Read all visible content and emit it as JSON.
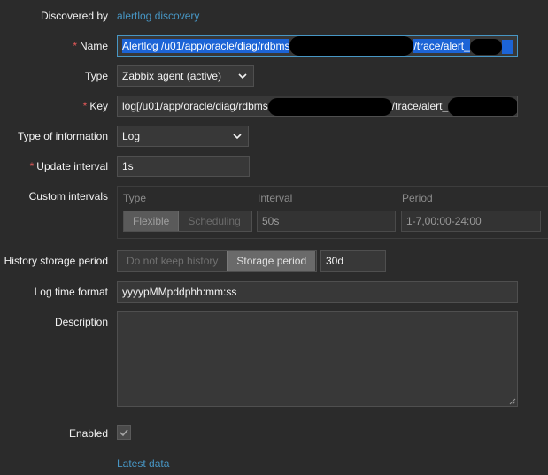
{
  "discovered_by": {
    "label": "Discovered by",
    "link": "alertlog discovery"
  },
  "name": {
    "label": "Name",
    "value_prefix": "Alertlog /u01/app/oracle/diag/rdbms",
    "value_middle": "/trace/alert_"
  },
  "type": {
    "label": "Type",
    "value": "Zabbix agent (active)"
  },
  "key": {
    "label": "Key",
    "value_prefix": "log[/u01/app/oracle/diag/rdbms",
    "value_middle": "/trace/alert_"
  },
  "type_of_information": {
    "label": "Type of information",
    "value": "Log"
  },
  "update_interval": {
    "label": "Update interval",
    "value": "1s"
  },
  "custom_intervals": {
    "label": "Custom intervals",
    "headers": [
      "Type",
      "Interval",
      "Period"
    ],
    "type_options": [
      "Flexible",
      "Scheduling"
    ],
    "selected_type": "Flexible",
    "interval": "50s",
    "period": "1-7,00:00-24:00"
  },
  "history_storage": {
    "label": "History storage period",
    "options": [
      "Do not keep history",
      "Storage period"
    ],
    "selected": "Storage period",
    "value": "30d"
  },
  "log_time_format": {
    "label": "Log time format",
    "value": "yyyypMMpddphh:mm:ss"
  },
  "description": {
    "label": "Description",
    "value": ""
  },
  "enabled": {
    "label": "Enabled",
    "checked": true
  },
  "latest_data_link": "Latest data",
  "required_marker": "*",
  "colors": {
    "background": "#2b2b2b",
    "field": "#383838",
    "link": "#4796c4",
    "required": "#e45959",
    "selection": "#1c64d6"
  }
}
